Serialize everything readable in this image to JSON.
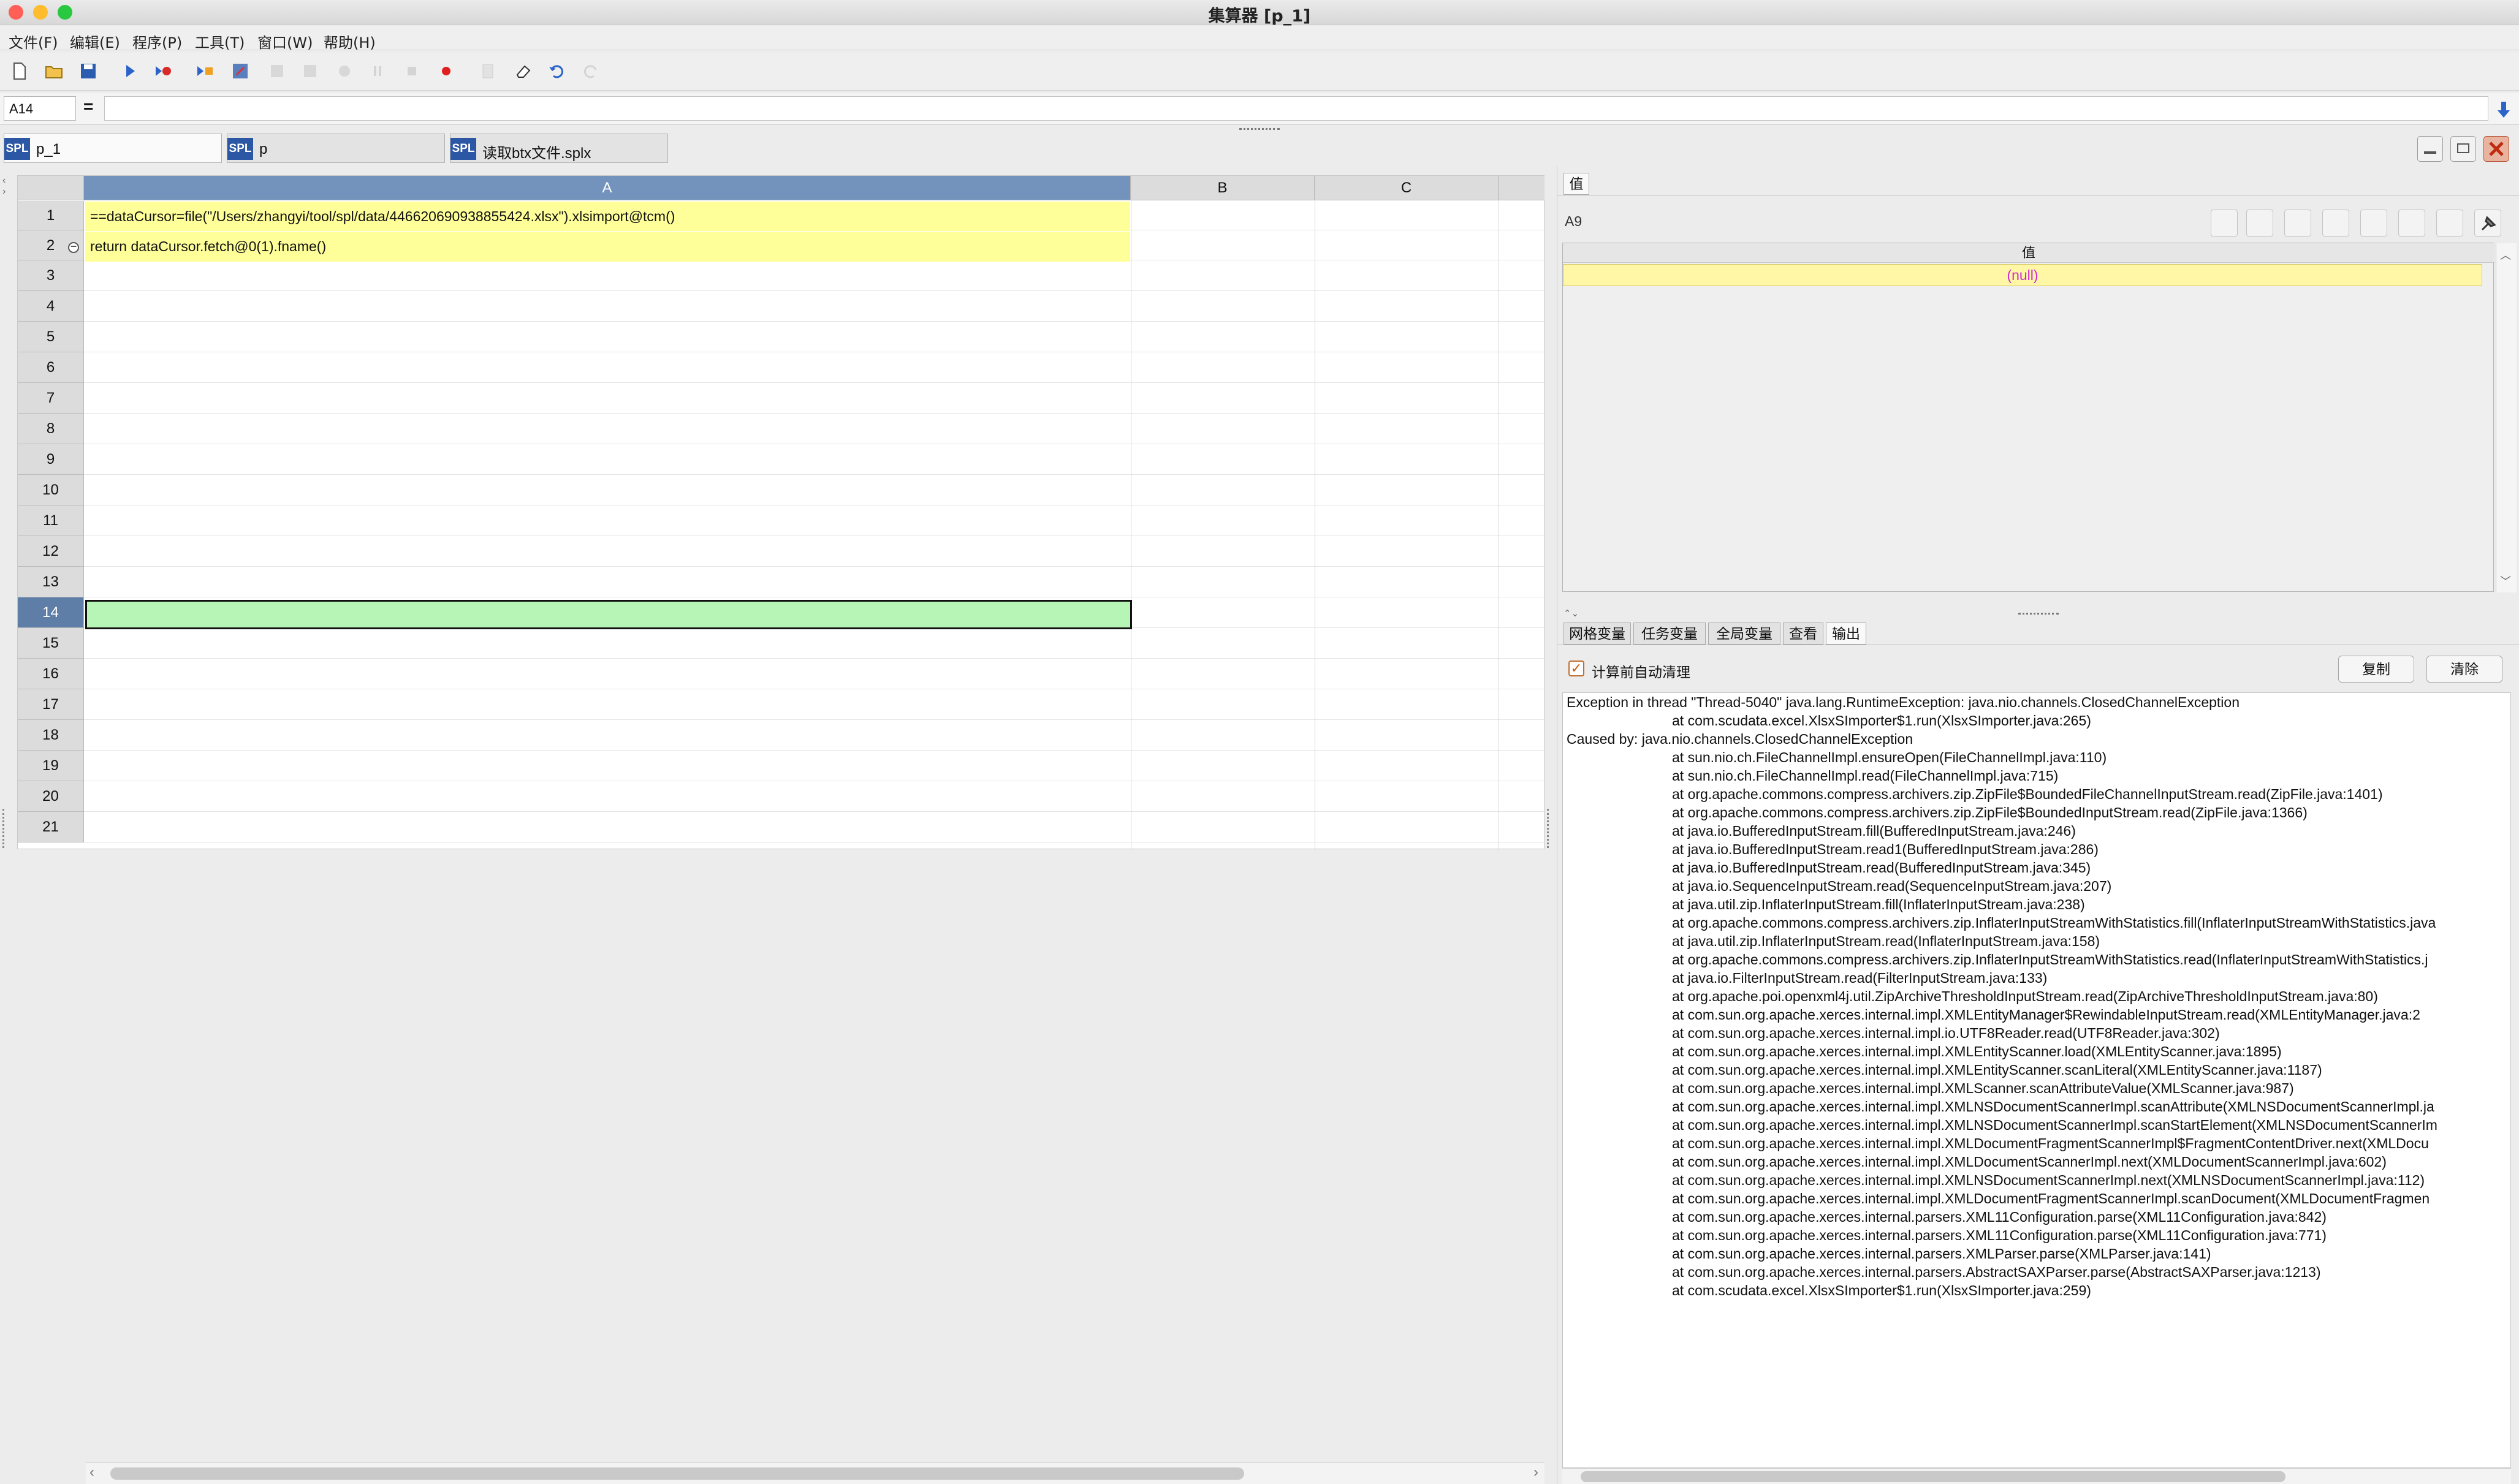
{
  "window": {
    "title": "集算器 [p_1]"
  },
  "menu": [
    "文件(F)",
    "编辑(E)",
    "程序(P)",
    "工具(T)",
    "窗口(W)",
    "帮助(H)"
  ],
  "formula": {
    "cell_ref": "A14",
    "equals": "=",
    "value": ""
  },
  "file_tabs": [
    {
      "badge": "SPL",
      "label": "p_1"
    },
    {
      "badge": "SPL",
      "label": "p"
    },
    {
      "badge": "SPL",
      "label": "读取btx文件.splx"
    }
  ],
  "grid": {
    "columns": [
      "A",
      "B",
      "C"
    ],
    "rows": [
      "1",
      "2",
      "3",
      "4",
      "5",
      "6",
      "7",
      "8",
      "9",
      "10",
      "11",
      "12",
      "13",
      "14",
      "15",
      "16",
      "17",
      "18",
      "19",
      "20",
      "21"
    ],
    "active_row": "14",
    "cells": {
      "A1": "==dataCursor=file(\"/Users/zhangyi/tool/spl/data/446620690938855424.xlsx\").xlsimport@tcm()",
      "A2": "return dataCursor.fetch@0(1).fname()"
    },
    "colors": {
      "code_cell": "#ffff99",
      "active_cell": "#b7f5b7",
      "header_active": "#7393bc"
    }
  },
  "value_panel": {
    "tab": "值",
    "cell_ref": "A9",
    "header": "值",
    "value": "(null)"
  },
  "bottom_tabs": [
    "网格变量",
    "任务变量",
    "全局变量",
    "查看",
    "输出"
  ],
  "active_bottom_tab": "输出",
  "output": {
    "auto_clear_label": "计算前自动清理",
    "auto_clear_checked": true,
    "copy_label": "复制",
    "clear_label": "清除",
    "lines": [
      {
        "indent": false,
        "text": "Exception in thread \"Thread-5040\" java.lang.RuntimeException: java.nio.channels.ClosedChannelException"
      },
      {
        "indent": true,
        "text": "at com.scudata.excel.XlsxSImporter$1.run(XlsxSImporter.java:265)"
      },
      {
        "indent": false,
        "text": "Caused by: java.nio.channels.ClosedChannelException"
      },
      {
        "indent": true,
        "text": "at sun.nio.ch.FileChannelImpl.ensureOpen(FileChannelImpl.java:110)"
      },
      {
        "indent": true,
        "text": "at sun.nio.ch.FileChannelImpl.read(FileChannelImpl.java:715)"
      },
      {
        "indent": true,
        "text": "at org.apache.commons.compress.archivers.zip.ZipFile$BoundedFileChannelInputStream.read(ZipFile.java:1401)"
      },
      {
        "indent": true,
        "text": "at org.apache.commons.compress.archivers.zip.ZipFile$BoundedInputStream.read(ZipFile.java:1366)"
      },
      {
        "indent": true,
        "text": "at java.io.BufferedInputStream.fill(BufferedInputStream.java:246)"
      },
      {
        "indent": true,
        "text": "at java.io.BufferedInputStream.read1(BufferedInputStream.java:286)"
      },
      {
        "indent": true,
        "text": "at java.io.BufferedInputStream.read(BufferedInputStream.java:345)"
      },
      {
        "indent": true,
        "text": "at java.io.SequenceInputStream.read(SequenceInputStream.java:207)"
      },
      {
        "indent": true,
        "text": "at java.util.zip.InflaterInputStream.fill(InflaterInputStream.java:238)"
      },
      {
        "indent": true,
        "text": "at org.apache.commons.compress.archivers.zip.InflaterInputStreamWithStatistics.fill(InflaterInputStreamWithStatistics.java"
      },
      {
        "indent": true,
        "text": "at java.util.zip.InflaterInputStream.read(InflaterInputStream.java:158)"
      },
      {
        "indent": true,
        "text": "at org.apache.commons.compress.archivers.zip.InflaterInputStreamWithStatistics.read(InflaterInputStreamWithStatistics.j"
      },
      {
        "indent": true,
        "text": "at java.io.FilterInputStream.read(FilterInputStream.java:133)"
      },
      {
        "indent": true,
        "text": "at org.apache.poi.openxml4j.util.ZipArchiveThresholdInputStream.read(ZipArchiveThresholdInputStream.java:80)"
      },
      {
        "indent": true,
        "text": "at com.sun.org.apache.xerces.internal.impl.XMLEntityManager$RewindableInputStream.read(XMLEntityManager.java:2"
      },
      {
        "indent": true,
        "text": "at com.sun.org.apache.xerces.internal.impl.io.UTF8Reader.read(UTF8Reader.java:302)"
      },
      {
        "indent": true,
        "text": "at com.sun.org.apache.xerces.internal.impl.XMLEntityScanner.load(XMLEntityScanner.java:1895)"
      },
      {
        "indent": true,
        "text": "at com.sun.org.apache.xerces.internal.impl.XMLEntityScanner.scanLiteral(XMLEntityScanner.java:1187)"
      },
      {
        "indent": true,
        "text": "at com.sun.org.apache.xerces.internal.impl.XMLScanner.scanAttributeValue(XMLScanner.java:987)"
      },
      {
        "indent": true,
        "text": "at com.sun.org.apache.xerces.internal.impl.XMLNSDocumentScannerImpl.scanAttribute(XMLNSDocumentScannerImpl.ja"
      },
      {
        "indent": true,
        "text": "at com.sun.org.apache.xerces.internal.impl.XMLNSDocumentScannerImpl.scanStartElement(XMLNSDocumentScannerIm"
      },
      {
        "indent": true,
        "text": "at com.sun.org.apache.xerces.internal.impl.XMLDocumentFragmentScannerImpl$FragmentContentDriver.next(XMLDocu"
      },
      {
        "indent": true,
        "text": "at com.sun.org.apache.xerces.internal.impl.XMLDocumentScannerImpl.next(XMLDocumentScannerImpl.java:602)"
      },
      {
        "indent": true,
        "text": "at com.sun.org.apache.xerces.internal.impl.XMLNSDocumentScannerImpl.next(XMLNSDocumentScannerImpl.java:112)"
      },
      {
        "indent": true,
        "text": "at com.sun.org.apache.xerces.internal.impl.XMLDocumentFragmentScannerImpl.scanDocument(XMLDocumentFragmen"
      },
      {
        "indent": true,
        "text": "at com.sun.org.apache.xerces.internal.parsers.XML11Configuration.parse(XML11Configuration.java:842)"
      },
      {
        "indent": true,
        "text": "at com.sun.org.apache.xerces.internal.parsers.XML11Configuration.parse(XML11Configuration.java:771)"
      },
      {
        "indent": true,
        "text": "at com.sun.org.apache.xerces.internal.parsers.XMLParser.parse(XMLParser.java:141)"
      },
      {
        "indent": true,
        "text": "at com.sun.org.apache.xerces.internal.parsers.AbstractSAXParser.parse(AbstractSAXParser.java:1213)"
      },
      {
        "indent": true,
        "text": "at com.scudata.excel.XlsxSImporter$1.run(XlsxSImporter.java:259)"
      }
    ]
  }
}
